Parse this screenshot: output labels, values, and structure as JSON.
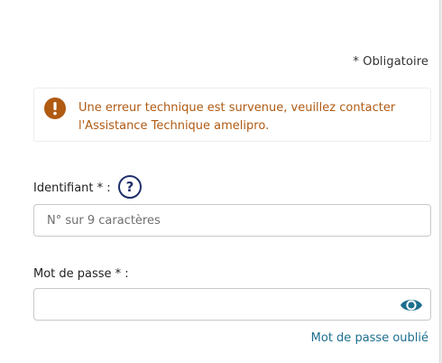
{
  "form": {
    "required_note": "* Obligatoire",
    "alert": {
      "icon": "exclamation-circle-icon",
      "color": "#b05a12",
      "message": "Une erreur technique est survenue, veuillez contacter l'Assistance Technique amelipro."
    },
    "identifier": {
      "label": "Identifiant * :",
      "help_symbol": "?",
      "placeholder": "N° sur 9 caractères",
      "value": ""
    },
    "password": {
      "label": "Mot de passe * :",
      "value": "",
      "toggle_icon": "eye-icon"
    },
    "forgot_password_link": "Mot de passe oublié"
  },
  "colors": {
    "alert_text": "#b05a12",
    "help_icon": "#1f2f6b",
    "link": "#1c6f8f",
    "eye_icon": "#1c6f8f"
  }
}
